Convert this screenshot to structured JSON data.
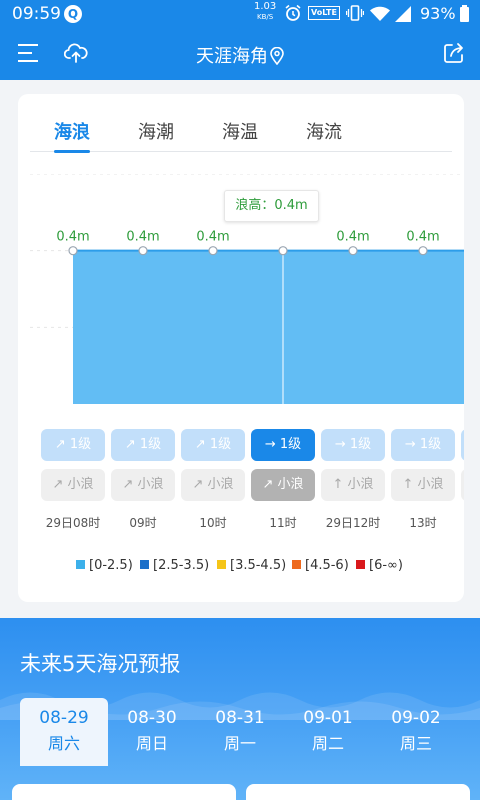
{
  "status_bar": {
    "time": "09:59",
    "q_icon": "Q",
    "net_speed": "1.03",
    "net_unit": "KB/S",
    "volte": "VoLTE",
    "battery": "93%",
    "icons": [
      "app-q-icon",
      "alarm-icon",
      "vibrate-icon",
      "wifi-icon",
      "signal-icon",
      "battery-icon"
    ]
  },
  "app_bar": {
    "title": "天涯海角",
    "icons": [
      "menu-icon",
      "cloud-upload-icon",
      "location-pin-icon",
      "share-icon"
    ]
  },
  "tabs": [
    {
      "label": "海浪",
      "active": true
    },
    {
      "label": "海潮",
      "active": false
    },
    {
      "label": "海温",
      "active": false
    },
    {
      "label": "海流",
      "active": false
    }
  ],
  "chart_data": {
    "type": "area",
    "x": [
      "29日08时",
      "09时",
      "10时",
      "11时",
      "29日12时",
      "13时"
    ],
    "values": [
      0.4,
      0.4,
      0.4,
      0.4,
      0.4,
      0.4
    ],
    "labels": [
      "0.4m",
      "0.4m",
      "0.4m",
      "0.4m",
      "0.4m",
      "0.4m"
    ],
    "selected_index": 3,
    "tooltip": "浪高：0.4m",
    "fill_color": "#62bdf4",
    "label_color": "#2e9c3b",
    "ylim": [
      0,
      0.6
    ],
    "grid": true
  },
  "wave_levels": [
    {
      "arrow": "↗",
      "label": "1级",
      "active": false
    },
    {
      "arrow": "↗",
      "label": "1级",
      "active": false
    },
    {
      "arrow": "↗",
      "label": "1级",
      "active": false
    },
    {
      "arrow": "→",
      "label": "1级",
      "active": true
    },
    {
      "arrow": "→",
      "label": "1级",
      "active": false
    },
    {
      "arrow": "→",
      "label": "1级",
      "active": false
    }
  ],
  "wave_types": [
    {
      "arrow": "↗",
      "label": "小浪",
      "active": false
    },
    {
      "arrow": "↗",
      "label": "小浪",
      "active": false
    },
    {
      "arrow": "↗",
      "label": "小浪",
      "active": false
    },
    {
      "arrow": "↗",
      "label": "小浪",
      "active": true
    },
    {
      "arrow": "↑",
      "label": "小浪",
      "active": false
    },
    {
      "arrow": "↑",
      "label": "小浪",
      "active": false
    }
  ],
  "times": [
    "29日08时",
    "09时",
    "10时",
    "11时",
    "29日12时",
    "13时"
  ],
  "legend": [
    {
      "label": "[0-2.5)",
      "color": "#3cb0ea"
    },
    {
      "label": "[2.5-3.5)",
      "color": "#1a6fc9"
    },
    {
      "label": "[3.5-4.5)",
      "color": "#f5c518"
    },
    {
      "label": "[4.5-6)",
      "color": "#ee6a1e"
    },
    {
      "label": "[6-∞)",
      "color": "#d9191c"
    }
  ],
  "forecast": {
    "title": "未来5天海况预报",
    "days": [
      {
        "date": "08-29",
        "week": "周六",
        "active": true
      },
      {
        "date": "08-30",
        "week": "周日",
        "active": false
      },
      {
        "date": "08-31",
        "week": "周一",
        "active": false
      },
      {
        "date": "09-01",
        "week": "周二",
        "active": false
      },
      {
        "date": "09-02",
        "week": "周三",
        "active": false
      }
    ]
  }
}
